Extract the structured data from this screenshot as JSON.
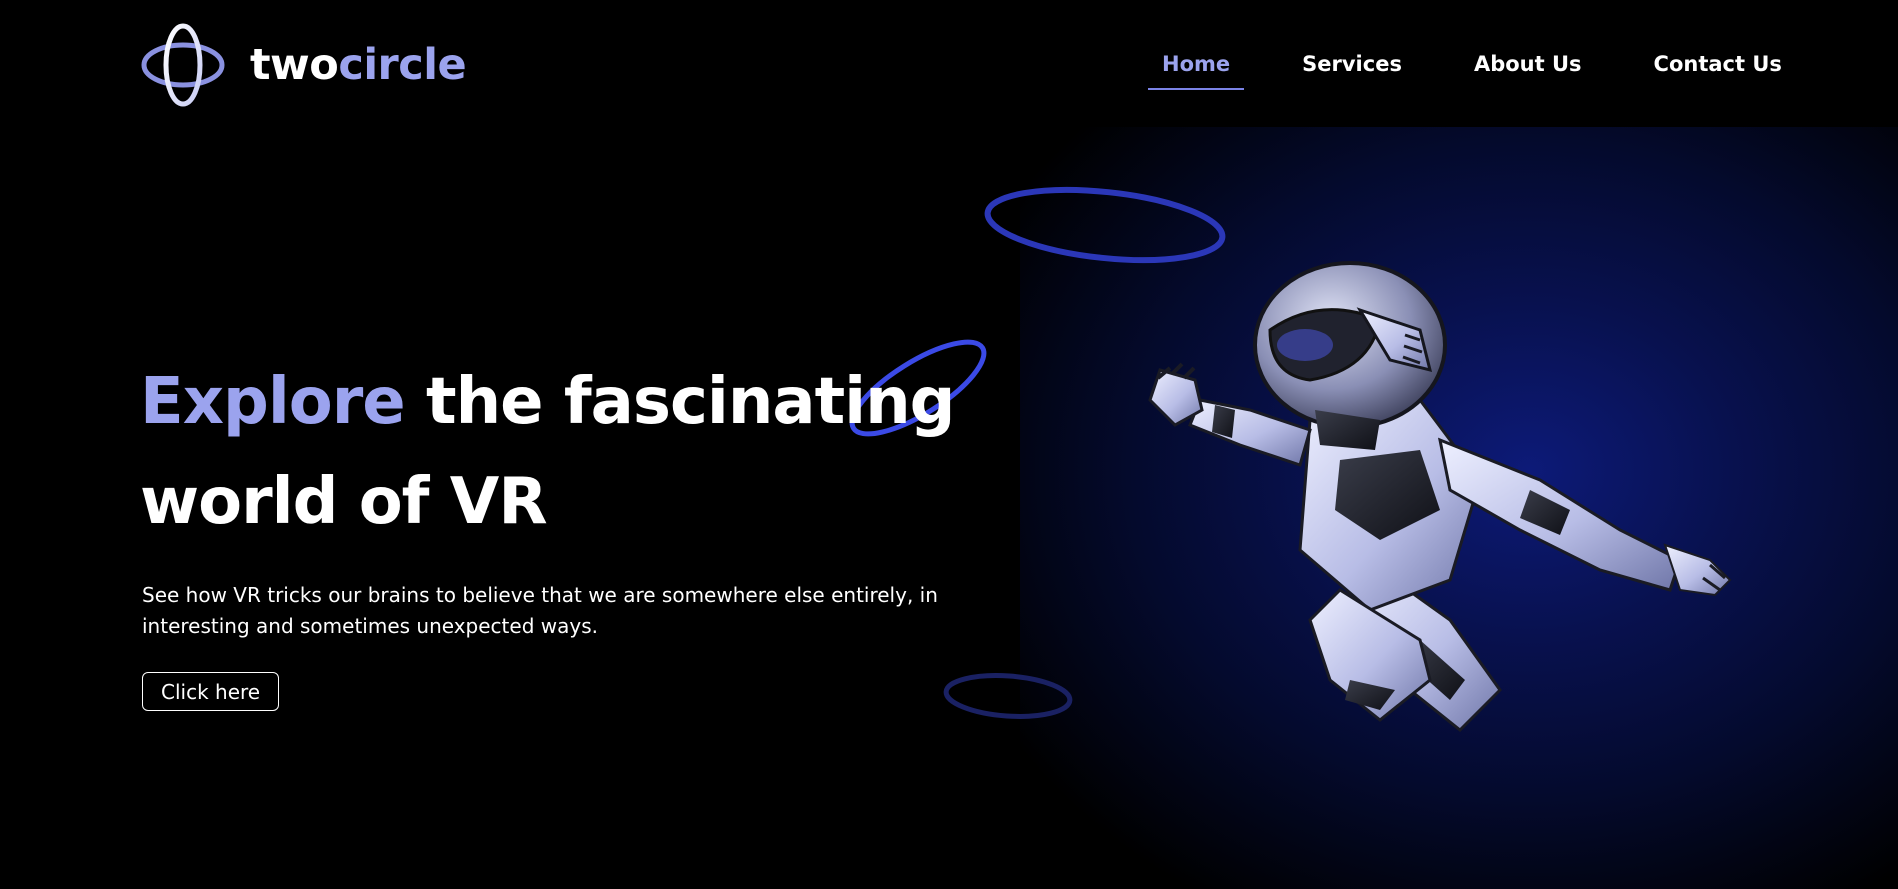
{
  "brand": {
    "name_part1": "two",
    "name_part2": "circle",
    "logo_icon": "two-circle-logo-icon"
  },
  "nav": {
    "items": [
      {
        "label": "Home",
        "active": true
      },
      {
        "label": "Services",
        "active": false
      },
      {
        "label": "About Us",
        "active": false
      },
      {
        "label": "Contact Us",
        "active": false
      }
    ]
  },
  "hero": {
    "title_accent": "Explore",
    "title_rest_line1": " the fascinating",
    "title_line2": "world of VR",
    "description": "See how VR tricks our brains to believe that we are somewhere else entirely, in interesting and sometimes unexpected ways.",
    "cta_label": "Click here",
    "image_icon": "flying-robot-illustration"
  },
  "colors": {
    "background": "#000000",
    "accent": "#9ba3ee",
    "ring_blue": "#3a48d8",
    "glow": "#0d1a78"
  }
}
